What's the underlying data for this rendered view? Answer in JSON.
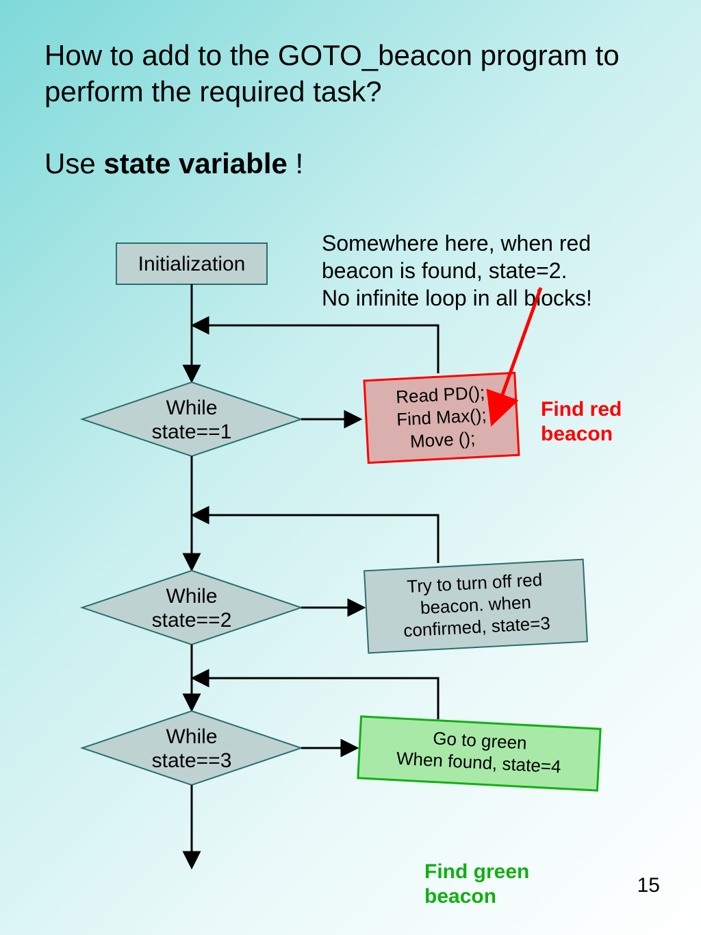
{
  "title": "How to add to the GOTO_beacon program to perform the required task?",
  "subtitle_prefix": "Use ",
  "subtitle_bold": "state variable",
  "subtitle_suffix": " !",
  "note_line1": "Somewhere here, when red",
  "note_line2": "beacon is found, state=2.",
  "note_line3": "No infinite loop in all blocks!",
  "init_box": "Initialization",
  "diamond1_l1": "While",
  "diamond1_l2": "state==1",
  "diamond2_l1": "While",
  "diamond2_l2": "state==2",
  "diamond3_l1": "While",
  "diamond3_l2": "state==3",
  "proc1_l1": "Read PD();",
  "proc1_l2": "Find Max();",
  "proc1_l3": "Move ();",
  "proc2_l1": "Try to turn off red",
  "proc2_l2": "beacon. when",
  "proc2_l3": "confirmed, state=3",
  "proc3_l1": "Go to green",
  "proc3_l2": "When found, state=4",
  "find_red_l1": "Find red",
  "find_red_l2": "beacon",
  "find_green_l1": "Find green",
  "find_green_l2": "beacon",
  "page_number": "15",
  "colors": {
    "grey_fill": "#bfd2d2",
    "grey_stroke": "#2a6e6e",
    "red_fill": "#d9b0ad",
    "red_stroke": "#ff0000",
    "green_fill": "#a8e9a8",
    "green_stroke": "#12b012"
  }
}
